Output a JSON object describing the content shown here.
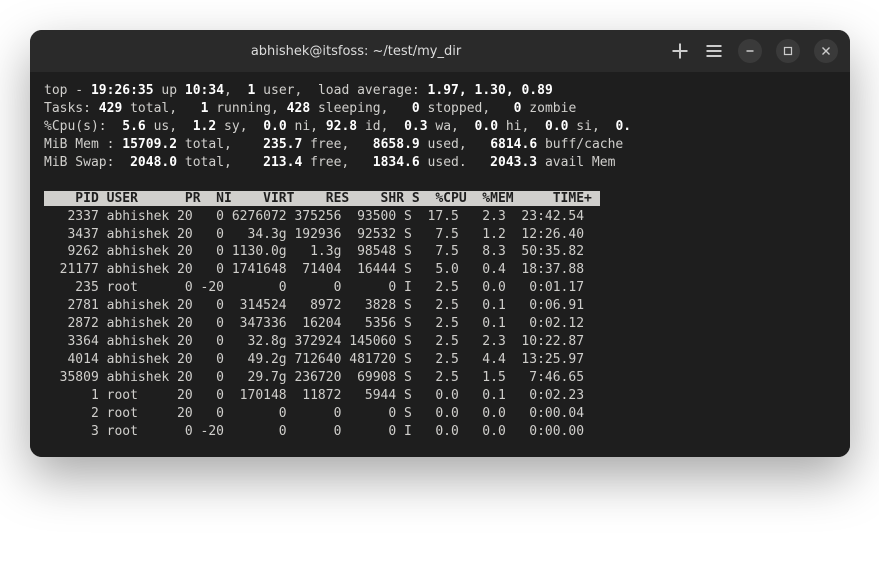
{
  "window": {
    "title": "abhishek@itsfoss: ~/test/my_dir"
  },
  "top": {
    "line1_pre": "top - ",
    "time": "19:26:35",
    "up": " up ",
    "uptime": "10:34",
    "comma": ",  ",
    "users_n": "1",
    "users_lbl": " user,  load average: ",
    "load": "1.97, 1.30, 0.89",
    "tasks_lbl": "Tasks:",
    "tasks_total": " 429 ",
    "tasks_total_lbl": "total,   ",
    "tasks_run": "1",
    "tasks_run_lbl": " running, ",
    "tasks_sleep": "428",
    "tasks_sleep_lbl": " sleeping,   ",
    "tasks_stop": "0",
    "tasks_stop_lbl": " stopped,   ",
    "tasks_zomb": "0",
    "tasks_zomb_lbl": " zombie",
    "cpu_lbl": "%Cpu(s):  ",
    "cpu_us": "5.6",
    "cpu_us_lbl": " us,  ",
    "cpu_sy": "1.2",
    "cpu_sy_lbl": " sy,  ",
    "cpu_ni": "0.0",
    "cpu_ni_lbl": " ni, ",
    "cpu_id": "92.8",
    "cpu_id_lbl": " id,  ",
    "cpu_wa": "0.3",
    "cpu_wa_lbl": " wa,  ",
    "cpu_hi": "0.0",
    "cpu_hi_lbl": " hi,  ",
    "cpu_si": "0.0",
    "cpu_si_lbl": " si,  ",
    "cpu_st": "0.",
    "mem_lbl": "MiB Mem : ",
    "mem_total": "15709.2",
    "mem_total_lbl": " total,    ",
    "mem_free": "235.7",
    "mem_free_lbl": " free,   ",
    "mem_used": "8658.9",
    "mem_used_lbl": " used,   ",
    "mem_buff": "6814.6",
    "mem_buff_lbl": " buff/cache",
    "swap_lbl": "MiB Swap:  ",
    "swap_total": "2048.0",
    "swap_total_lbl": " total,    ",
    "swap_free": "213.4",
    "swap_free_lbl": " free,   ",
    "swap_used": "1834.6",
    "swap_used_lbl": " used.   ",
    "swap_avail": "2043.3",
    "swap_avail_lbl": " avail Mem "
  },
  "headers": "    PID USER      PR  NI    VIRT    RES    SHR S  %CPU  %MEM     TIME+ ",
  "rows": [
    {
      "pid": "   2337",
      "user": "abhishek",
      "pr": "20",
      "ni": "  0",
      "virt": "6276072",
      "res": "375256",
      "shr": " 93500",
      "s": "S",
      "cpu": " 17.5",
      "mem": "  2.3",
      "time": " 23:42.54"
    },
    {
      "pid": "   3437",
      "user": "abhishek",
      "pr": "20",
      "ni": "  0",
      "virt": "  34.3g",
      "res": "192936",
      "shr": " 92532",
      "s": "S",
      "cpu": "  7.5",
      "mem": "  1.2",
      "time": " 12:26.40"
    },
    {
      "pid": "   9262",
      "user": "abhishek",
      "pr": "20",
      "ni": "  0",
      "virt": "1130.0g",
      "res": "  1.3g",
      "shr": " 98548",
      "s": "S",
      "cpu": "  7.5",
      "mem": "  8.3",
      "time": " 50:35.82"
    },
    {
      "pid": "  21177",
      "user": "abhishek",
      "pr": "20",
      "ni": "  0",
      "virt": "1741648",
      "res": " 71404",
      "shr": " 16444",
      "s": "S",
      "cpu": "  5.0",
      "mem": "  0.4",
      "time": " 18:37.88"
    },
    {
      "pid": "    235",
      "user": "root    ",
      "pr": " 0",
      "ni": "-20",
      "virt": "      0",
      "res": "     0",
      "shr": "     0",
      "s": "I",
      "cpu": "  2.5",
      "mem": "  0.0",
      "time": "  0:01.17"
    },
    {
      "pid": "   2781",
      "user": "abhishek",
      "pr": "20",
      "ni": "  0",
      "virt": " 314524",
      "res": "  8972",
      "shr": "  3828",
      "s": "S",
      "cpu": "  2.5",
      "mem": "  0.1",
      "time": "  0:06.91"
    },
    {
      "pid": "   2872",
      "user": "abhishek",
      "pr": "20",
      "ni": "  0",
      "virt": " 347336",
      "res": " 16204",
      "shr": "  5356",
      "s": "S",
      "cpu": "  2.5",
      "mem": "  0.1",
      "time": "  0:02.12"
    },
    {
      "pid": "   3364",
      "user": "abhishek",
      "pr": "20",
      "ni": "  0",
      "virt": "  32.8g",
      "res": "372924",
      "shr": "145060",
      "s": "S",
      "cpu": "  2.5",
      "mem": "  2.3",
      "time": " 10:22.87"
    },
    {
      "pid": "   4014",
      "user": "abhishek",
      "pr": "20",
      "ni": "  0",
      "virt": "  49.2g",
      "res": "712640",
      "shr": "481720",
      "s": "S",
      "cpu": "  2.5",
      "mem": "  4.4",
      "time": " 13:25.97"
    },
    {
      "pid": "  35809",
      "user": "abhishek",
      "pr": "20",
      "ni": "  0",
      "virt": "  29.7g",
      "res": "236720",
      "shr": " 69908",
      "s": "S",
      "cpu": "  2.5",
      "mem": "  1.5",
      "time": "  7:46.65"
    },
    {
      "pid": "      1",
      "user": "root    ",
      "pr": "20",
      "ni": "  0",
      "virt": " 170148",
      "res": " 11872",
      "shr": "  5944",
      "s": "S",
      "cpu": "  0.0",
      "mem": "  0.1",
      "time": "  0:02.23"
    },
    {
      "pid": "      2",
      "user": "root    ",
      "pr": "20",
      "ni": "  0",
      "virt": "      0",
      "res": "     0",
      "shr": "     0",
      "s": "S",
      "cpu": "  0.0",
      "mem": "  0.0",
      "time": "  0:00.04"
    },
    {
      "pid": "      3",
      "user": "root    ",
      "pr": " 0",
      "ni": "-20",
      "virt": "      0",
      "res": "     0",
      "shr": "     0",
      "s": "I",
      "cpu": "  0.0",
      "mem": "  0.0",
      "time": "  0:00.00"
    }
  ]
}
